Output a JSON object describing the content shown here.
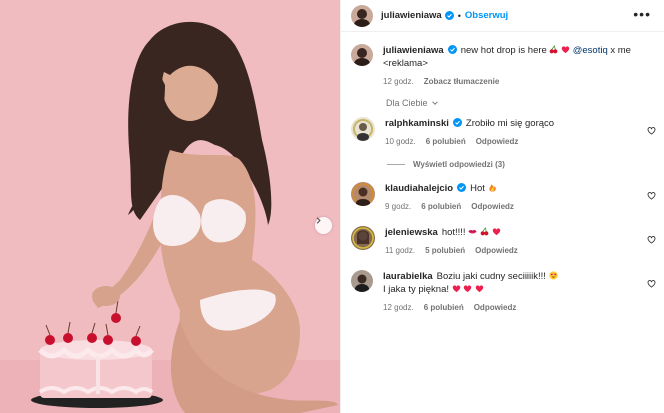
{
  "post": {
    "username": "juliawieniawa",
    "follow_label": "Obserwuj",
    "separator": "•"
  },
  "caption": {
    "username": "juliawieniawa",
    "text": "new hot drop is here",
    "mention": "@esotiq",
    "text_after": "x me",
    "line2": "<reklama>",
    "time": "12 godz.",
    "translate": "Zobacz tłumaczenie"
  },
  "sort_label": "Dla Ciebie",
  "comments": [
    {
      "username": "ralphkaminski",
      "text": "Zrobiło mi się gorąco",
      "time": "10 godz.",
      "likes": "6 polubień",
      "reply": "Odpowiedz",
      "view_replies": "Wyświetl odpowiedzi (3)"
    },
    {
      "username": "klaudiahalejcio",
      "text": "Hot",
      "time": "9 godz.",
      "likes": "6 polubień",
      "reply": "Odpowiedz"
    },
    {
      "username": "jeleniewska",
      "text": "hot!!!!",
      "time": "11 godz.",
      "likes": "5 polubień",
      "reply": "Odpowiedz"
    },
    {
      "username": "laurabielka",
      "text": "Boziu jaki cudny seciiiiik!!!",
      "line2": "I jaka ty piękna!",
      "time": "12 godz.",
      "likes": "6 polubień",
      "reply": "Odpowiedz"
    }
  ],
  "colors": {
    "photo_background": "#f0bcc0",
    "link_blue": "#0095f6",
    "verified_blue": "#0095f6",
    "muted_text": "#737373",
    "heart_red": "#ed1f4f"
  },
  "icons": [
    "verified-badge-icon",
    "more-options-icon",
    "heart-icon",
    "chevron-right-icon",
    "chevron-down-icon"
  ]
}
